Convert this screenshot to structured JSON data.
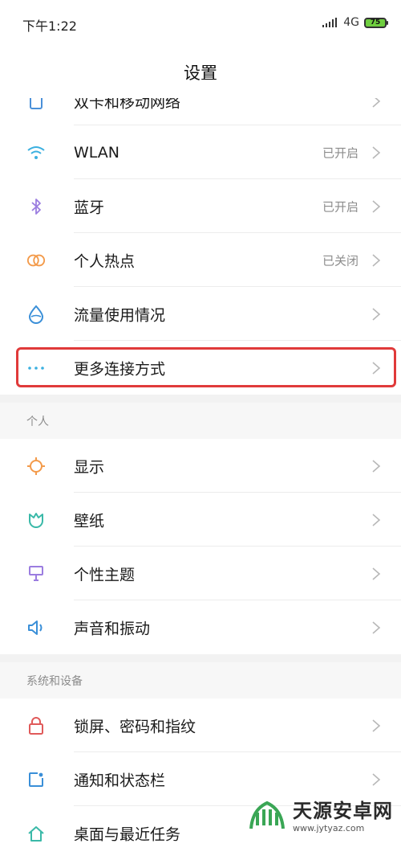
{
  "status_bar": {
    "time": "下午1:22",
    "network": "4G",
    "battery": "75"
  },
  "header": {
    "title": "设置"
  },
  "sections": [
    {
      "items": [
        {
          "label": "双卡和移动网络",
          "value": "",
          "icon": "sim-card-icon",
          "color": "#4a90d9"
        },
        {
          "label": "WLAN",
          "value": "已开启",
          "icon": "wifi-icon",
          "color": "#3bb0e0"
        },
        {
          "label": "蓝牙",
          "value": "已开启",
          "icon": "bluetooth-icon",
          "color": "#9b7de0"
        },
        {
          "label": "个人热点",
          "value": "已关闭",
          "icon": "hotspot-icon",
          "color": "#f39a4a"
        },
        {
          "label": "流量使用情况",
          "value": "",
          "icon": "data-drop-icon",
          "color": "#3a8fd8"
        },
        {
          "label": "更多连接方式",
          "value": "",
          "icon": "more-dots-icon",
          "color": "#3bb0e0"
        }
      ]
    },
    {
      "header": "个人",
      "items": [
        {
          "label": "显示",
          "value": "",
          "icon": "sun-icon",
          "color": "#f39a4a"
        },
        {
          "label": "壁纸",
          "value": "",
          "icon": "tulip-icon",
          "color": "#3ab9a8"
        },
        {
          "label": "个性主题",
          "value": "",
          "icon": "brush-icon",
          "color": "#9b7de0"
        },
        {
          "label": "声音和振动",
          "value": "",
          "icon": "speaker-icon",
          "color": "#3a8fd8"
        }
      ]
    },
    {
      "header": "系统和设备",
      "items": [
        {
          "label": "锁屏、密码和指纹",
          "value": "",
          "icon": "lock-icon",
          "color": "#e05a5a"
        },
        {
          "label": "通知和状态栏",
          "value": "",
          "icon": "notification-icon",
          "color": "#3a8fd8"
        },
        {
          "label": "桌面与最近任务",
          "value": "",
          "icon": "home-icon",
          "color": "#3ab9a8"
        }
      ]
    }
  ],
  "watermark": {
    "title": "天源安卓网",
    "url": "www.jytyaz.com",
    "colors": [
      "#3aa655",
      "#2a2a2a"
    ]
  }
}
